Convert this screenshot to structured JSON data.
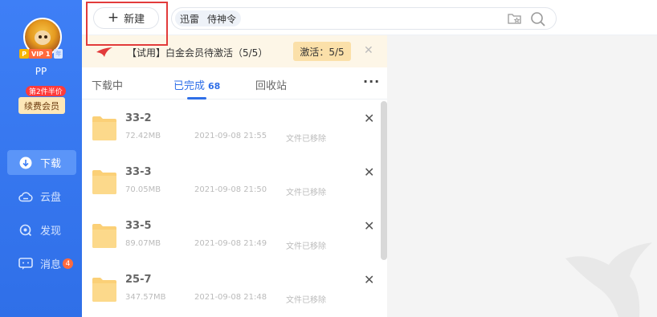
{
  "sidebar": {
    "vip_label": "VIP 1",
    "vip_p": "P",
    "vip_year": "年",
    "username": "PP",
    "promo": "第2件半价",
    "renew": "续费会员",
    "nav": [
      {
        "label": "下载",
        "icon": "download-icon",
        "active": true
      },
      {
        "label": "云盘",
        "icon": "cloud-icon",
        "active": false
      },
      {
        "label": "发现",
        "icon": "discover-icon",
        "active": false
      },
      {
        "label": "消息",
        "icon": "message-icon",
        "active": false,
        "badge": "4"
      }
    ]
  },
  "topbar": {
    "new_label": "新建",
    "search_chip_1": "迅雷",
    "search_chip_2": "侍神令"
  },
  "banner": {
    "text": "【试用】白金会员待激活（5/5）",
    "activate": "激活：5/5"
  },
  "tabs": {
    "downloading": "下载中",
    "completed": "已完成",
    "completed_count": "68",
    "recycle": "回收站",
    "more": "···"
  },
  "files": [
    {
      "name": "33-2",
      "size": "72.42MB",
      "date": "2021-09-08 21:55",
      "status": "文件已移除"
    },
    {
      "name": "33-3",
      "size": "70.05MB",
      "date": "2021-09-08 21:50",
      "status": "文件已移除"
    },
    {
      "name": "33-5",
      "size": "89.07MB",
      "date": "2021-09-08 21:49",
      "status": "文件已移除"
    },
    {
      "name": "25-7",
      "size": "347.57MB",
      "date": "2021-09-08 21:48",
      "status": "文件已移除"
    }
  ],
  "colors": {
    "accent": "#2f6fe8",
    "sidebar": "#3e7ff6",
    "highlight": "#e23b3b"
  }
}
